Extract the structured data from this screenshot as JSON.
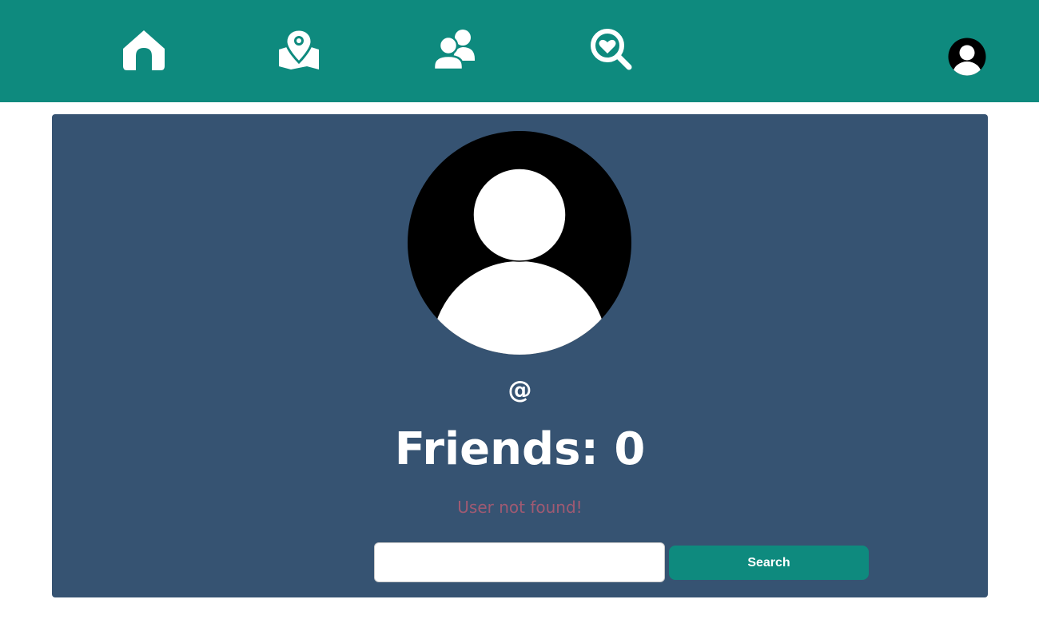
{
  "colors": {
    "topbar": "#0e8a7e",
    "card": "#365372",
    "error": "#a05a72",
    "button": "#0e8a7e"
  },
  "nav": {
    "items": [
      {
        "icon": "home-icon"
      },
      {
        "icon": "map-location-icon"
      },
      {
        "icon": "friends-icon"
      },
      {
        "icon": "search-heart-icon"
      }
    ],
    "account_icon": "user-avatar-icon"
  },
  "profile": {
    "handle": "@",
    "friends_label": "Friends: 0",
    "error_message": "User not found!"
  },
  "search": {
    "value": "",
    "placeholder": "",
    "button_label": "Search"
  }
}
